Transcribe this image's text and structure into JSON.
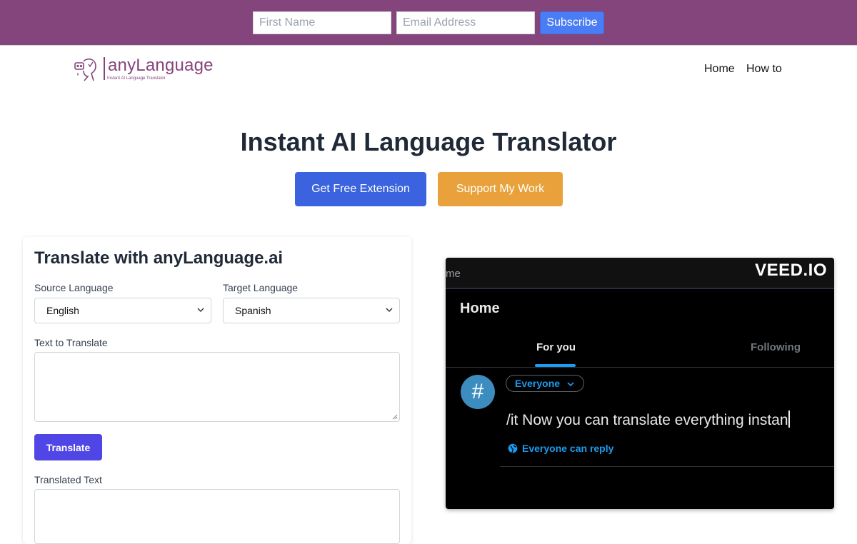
{
  "subscribe": {
    "first_name_placeholder": "First Name",
    "email_placeholder": "Email Address",
    "button": "Subscribe",
    "bar_color": "#84447c",
    "button_color": "#4a7cf5"
  },
  "header": {
    "logo_name": "anyLanguage",
    "logo_tagline": "Instant AI Language Translator",
    "nav": [
      "Home",
      "How to"
    ]
  },
  "hero": {
    "title": "Instant AI Language Translator",
    "primary_button": "Get Free Extension",
    "secondary_button": "Support My Work",
    "primary_color": "#3b63e0",
    "secondary_color": "#e9a23b"
  },
  "translator": {
    "title": "Translate with anyLanguage.ai",
    "source_label": "Source Language",
    "source_value": "English",
    "target_label": "Target Language",
    "target_value": "Spanish",
    "input_label": "Text to Translate",
    "input_value": "",
    "button": "Translate",
    "output_label": "Translated Text",
    "output_value": ""
  },
  "video": {
    "watermark": "VEED.IO",
    "partial_tab": "me",
    "home": "Home",
    "tabs": [
      "For you",
      "Following"
    ],
    "avatar_symbol": "#",
    "audience": "Everyone",
    "compose_text": "/it Now you can translate everything instan",
    "reply_setting": "Everyone can reply"
  }
}
